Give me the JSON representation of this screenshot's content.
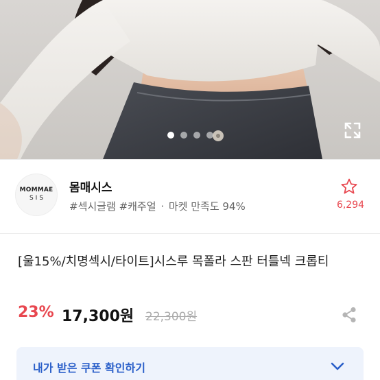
{
  "hero": {
    "photo_alt": "product-photo",
    "slide_count": 4,
    "active_slide": 0
  },
  "seller": {
    "logo_line1": "MOMMAE",
    "logo_line2": "SIS",
    "name": "몸매시스",
    "tag1": "#섹시글램",
    "tag2": "#캐주얼",
    "separator": "·",
    "satisfaction": "마켓 만족도 94%",
    "like_count": "6,294"
  },
  "product": {
    "title": "[울15%/치명섹시/타이트]시스루 목폴라 스판 터틀넥 크롭티",
    "discount": "23%",
    "price": "17,300원",
    "original_price": "22,300원"
  },
  "coupon": {
    "label": "내가 받은 쿠폰 확인하기"
  },
  "colors": {
    "accent_red": "#e8474f",
    "coupon_blue": "#2a5fc9",
    "coupon_bg": "#eef3fc"
  }
}
